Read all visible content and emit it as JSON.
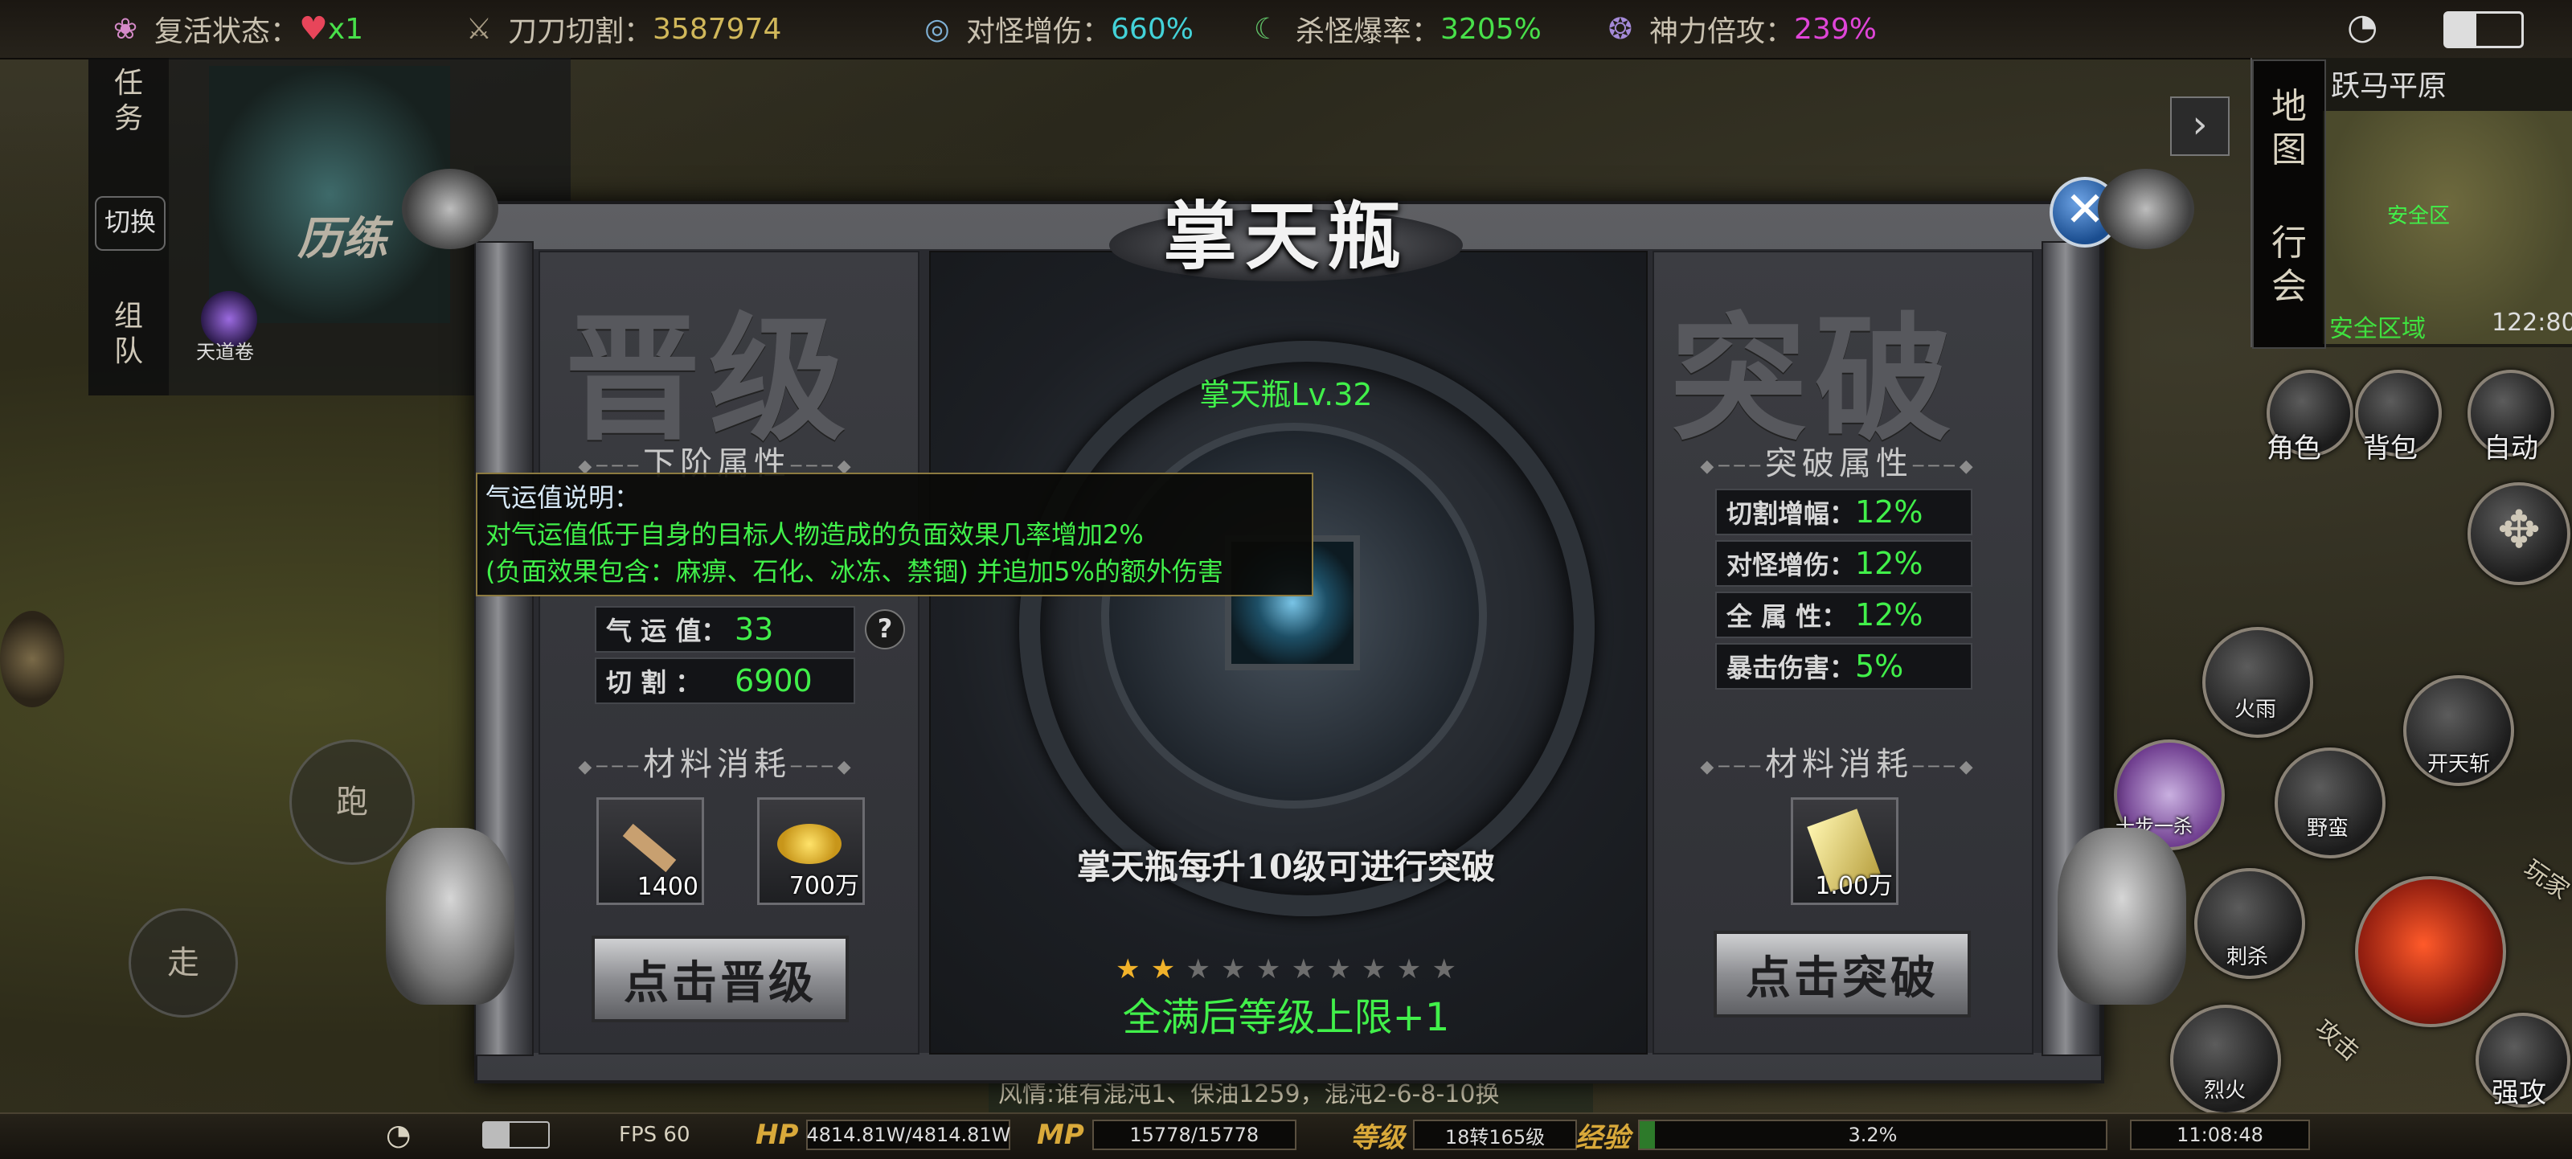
{
  "topbar": {
    "revive": {
      "label": "复活状态：",
      "value": "x1",
      "heart_color": "#e8455a"
    },
    "cut": {
      "label": "刀刀切割：",
      "value": "3587974"
    },
    "monster_dmg": {
      "label": "对怪增伤：",
      "value": "660%"
    },
    "kill_drop": {
      "label": "杀怪爆率：",
      "value": "3205%"
    },
    "divine_atk": {
      "label": "神力倍攻：",
      "value": "239%"
    }
  },
  "left_panel": {
    "tab1": "任务",
    "tab_switch": "切换",
    "tab2": "组队",
    "quest_label": "历练",
    "quest_scroll": "天道卷"
  },
  "minimap": {
    "map_name": "跃马平原",
    "tabs": [
      "地图",
      "行会"
    ],
    "safe_zone": "安全区域",
    "zone_marker": "安全区",
    "coords": "122:80"
  },
  "dialog": {
    "title": "掌天瓶",
    "left": {
      "big_title": "晋级",
      "attr_title": "下阶属性",
      "stats": [
        {
          "label": "气 运 值：",
          "value": "33"
        },
        {
          "label": "切    割  ：",
          "value": "6900"
        }
      ],
      "help": "?",
      "material_title": "材料消耗",
      "materials": [
        {
          "icon": "wood-plank-icon",
          "qty": "1400"
        },
        {
          "icon": "gold-coins-icon",
          "qty": "700万"
        }
      ],
      "button": "点击晋级"
    },
    "center": {
      "level": "掌天瓶Lv.32",
      "banner": "掌天瓶每升10级可进行突破",
      "stars_total": 10,
      "stars_lit": 2,
      "goal": "全满后等级上限+1"
    },
    "right": {
      "big_title": "突破",
      "attr_title": "突破属性",
      "stats": [
        {
          "label": "切割增幅：",
          "value": "12%"
        },
        {
          "label": "对怪增伤：",
          "value": "12%"
        },
        {
          "label": "全 属 性：",
          "value": "12%"
        },
        {
          "label": "暴击伤害：",
          "value": "5%"
        }
      ],
      "material_title": "材料消耗",
      "materials": [
        {
          "icon": "talisman-scroll-icon",
          "qty": "1.00万"
        }
      ],
      "button": "点击突破"
    },
    "tooltip": {
      "title": "气运值说明：",
      "line1": "对气运值低于自身的目标人物造成的负面效果几率增加2%",
      "line2": "(负面效果包含：麻痹、石化、冰冻、禁锢) 并追加5%的额外伤害"
    }
  },
  "right_skills": {
    "role": "角色",
    "bag": "背包",
    "auto": "自动",
    "fire_rain": "火雨",
    "kill": "开天斩",
    "ten_step": "十步一杀",
    "wild": "野蛮",
    "assassin": "刺杀",
    "fire": "烈火",
    "strong_atk": "强攻",
    "player": "玩家",
    "attack_mode": "攻击"
  },
  "joystick": {
    "run": "跑",
    "walk": "走"
  },
  "chat": "风情:谁有混沌1、保油1259，混沌2-6-8-10换",
  "bottombar": {
    "fps": "FPS 60",
    "hp_label": "HP",
    "hp": "4814.81W/4814.81W",
    "mp_label": "MP",
    "mp": "15778/15778",
    "level_label": "等级",
    "level": "18转165级",
    "exp_label": "经验",
    "exp": "3.2%",
    "exp_fraction": 0.032,
    "time": "11:08:48"
  }
}
